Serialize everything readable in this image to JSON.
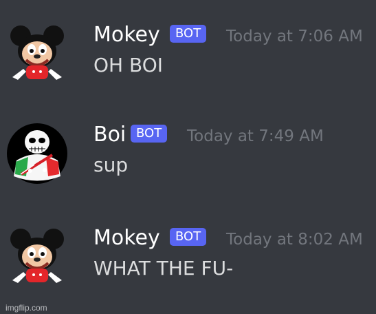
{
  "app": {
    "background_color": "#36393f",
    "username_color": "#ffffff",
    "message_color": "#dcddde",
    "timestamp_color": "#72767d",
    "bot_badge_color": "#5865f2",
    "watermark": "imgflip.com"
  },
  "messages": [
    {
      "username": "Mokey",
      "badge": "BOT",
      "timestamp": "Today at 7:06 AM",
      "text": "OH BOI",
      "avatar_icon": "mokey-avatar-icon"
    },
    {
      "username": "Boi",
      "badge": "BOT",
      "timestamp": "Today at 7:49 AM",
      "text": "sup",
      "avatar_icon": "boi-avatar-icon"
    },
    {
      "username": "Mokey",
      "badge": "BOT",
      "timestamp": "Today at 8:02 AM",
      "text": "WHAT THE FU-",
      "avatar_icon": "mokey-avatar-icon"
    }
  ]
}
